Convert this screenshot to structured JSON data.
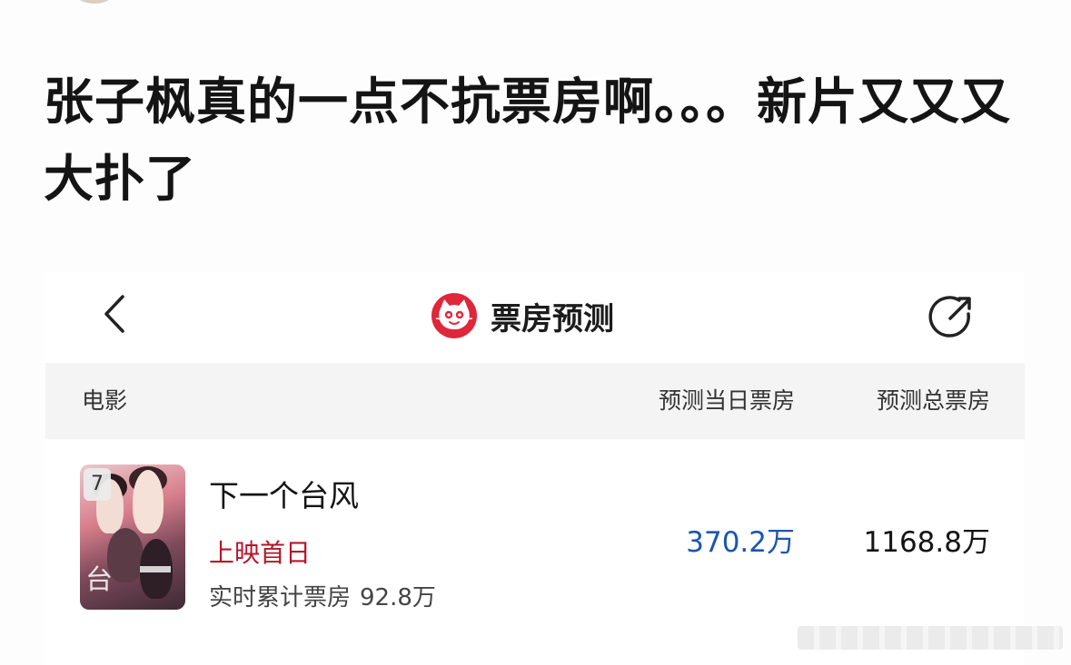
{
  "post": {
    "text": "张子枫真的一点不抗票房啊。。。新片又又又大扑了"
  },
  "app": {
    "title": "票房预测",
    "brand_color": "#e0263a"
  },
  "table": {
    "col_movie": "电影",
    "col_day": "预测当日票房",
    "col_total": "预测总票房"
  },
  "movie": {
    "rank": "7",
    "title": "下一个台风",
    "release_tag": "上映首日",
    "cumulative_label": "实时累计票房",
    "cumulative_value": "92.8万",
    "predicted_day": "370.2万",
    "predicted_total": "1168.8万",
    "poster_text": "下一个台风"
  },
  "colors": {
    "accent_blue": "#1a56b0",
    "release_red": "#b5162a",
    "header_bg": "#f4f4f4"
  },
  "icons": {
    "back": "chevron-left-icon",
    "logo": "cat-logo-icon",
    "share": "share-arrow-icon"
  }
}
